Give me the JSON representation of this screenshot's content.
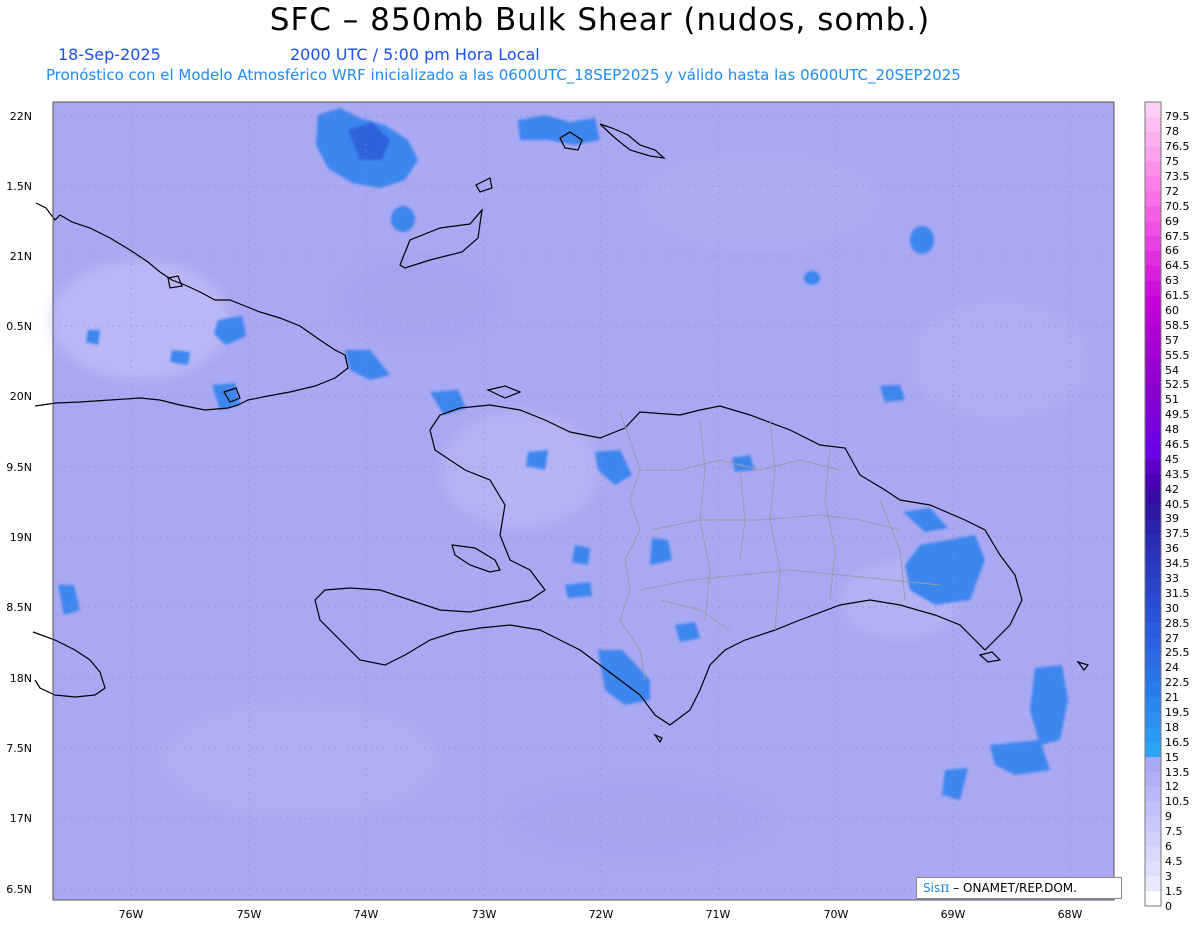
{
  "header": {
    "title": "SFC – 850mb Bulk Shear (nudos, somb.)",
    "date": "18-Sep-2025",
    "valid_time": "2000 UTC / 5:00 pm Hora Local",
    "forecast_info": "Pronóstico con el Modelo Atmosférico WRF inicializado a las 0600UTC_18SEP2025 y válido hasta las  0600UTC_20SEP2025"
  },
  "axes": {
    "lat_labels": [
      "22N",
      "1.5N",
      "21N",
      "0.5N",
      "20N",
      "9.5N",
      "19N",
      "8.5N",
      "18N",
      "7.5N",
      "17N",
      "6.5N"
    ],
    "lon_labels": [
      "76W",
      "75W",
      "74W",
      "73W",
      "72W",
      "71W",
      "70W",
      "69W",
      "68W"
    ]
  },
  "colorbar": {
    "labels": [
      "79.5",
      "78",
      "76.5",
      "75",
      "73.5",
      "72",
      "70.5",
      "69",
      "67.5",
      "66",
      "64.5",
      "63",
      "61.5",
      "60",
      "58.5",
      "57",
      "55.5",
      "54",
      "52.5",
      "51",
      "49.5",
      "48",
      "46.5",
      "45",
      "43.5",
      "42",
      "40.5",
      "39",
      "37.5",
      "36",
      "34.5",
      "33",
      "31.5",
      "30",
      "28.5",
      "27",
      "25.5",
      "24",
      "22.5",
      "21",
      "19.5",
      "18",
      "16.5",
      "15",
      "13.5",
      "12",
      "10.5",
      "9",
      "7.5",
      "6",
      "4.5",
      "3",
      "1.5",
      "0"
    ],
    "colors": [
      "#ffd0f5",
      "#ffbff2",
      "#ffaff0",
      "#ff9fee",
      "#ff8feb",
      "#ff7fe9",
      "#fb6fe8",
      "#f55fe6",
      "#ef4fe4",
      "#e83fe2",
      "#e02fe0",
      "#d81fde",
      "#cf10dc",
      "#c500da",
      "#bb00d8",
      "#b100d6",
      "#a700d4",
      "#9d00d2",
      "#9300d0",
      "#8900ce",
      "#8200d6",
      "#7a00de",
      "#7200e4",
      "#6a00e8",
      "#5c00c8",
      "#4a00b4",
      "#3a0aa8",
      "#3018a4",
      "#2a22ac",
      "#2a2cb4",
      "#2a34bc",
      "#2a3cc4",
      "#2a44cc",
      "#2a4cd2",
      "#2a54d8",
      "#2a5cde",
      "#2a64e2",
      "#2a6ce6",
      "#2a74ea",
      "#2a7cee",
      "#2a86f0",
      "#2a90f2",
      "#2a9af4",
      "#2ba4f6",
      "#a8a8f8",
      "#b0b0f8",
      "#b8b8fa",
      "#c0c0fa",
      "#c8c8fc",
      "#d0d0fc",
      "#d8d8fd",
      "#e0e0fe",
      "#e8e8fe",
      "#ffffff"
    ]
  },
  "credit": {
    "sis": "Sis",
    "pi": "π",
    "org": "– ONAMET/REP.DOM."
  }
}
